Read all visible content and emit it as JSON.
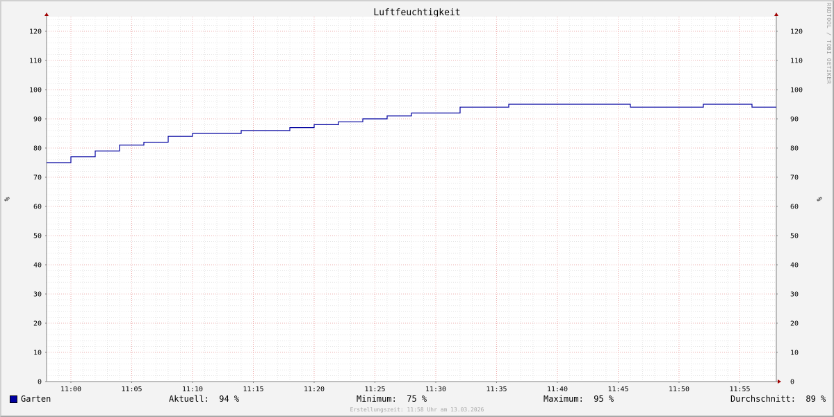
{
  "chart_data": {
    "type": "line",
    "title": "Luftfeuchtigkeit",
    "ylabel": "%",
    "ylim": [
      0,
      125
    ],
    "yticks": [
      0,
      10,
      20,
      30,
      40,
      50,
      60,
      70,
      80,
      90,
      100,
      110,
      120
    ],
    "xlim": [
      "10:58",
      "11:58"
    ],
    "xticks": [
      "11:00",
      "11:05",
      "11:10",
      "11:15",
      "11:20",
      "11:25",
      "11:30",
      "11:35",
      "11:40",
      "11:45",
      "11:50",
      "11:55"
    ],
    "grid": true,
    "line_style": "step",
    "series": [
      {
        "name": "Garten",
        "color": "#00009f",
        "points": [
          [
            "10:58",
            75
          ],
          [
            "11:00",
            77
          ],
          [
            "11:02",
            79
          ],
          [
            "11:04",
            81
          ],
          [
            "11:06",
            82
          ],
          [
            "11:08",
            84
          ],
          [
            "11:10",
            85
          ],
          [
            "11:14",
            86
          ],
          [
            "11:18",
            87
          ],
          [
            "11:20",
            88
          ],
          [
            "11:22",
            89
          ],
          [
            "11:24",
            90
          ],
          [
            "11:26",
            91
          ],
          [
            "11:28",
            92
          ],
          [
            "11:32",
            94
          ],
          [
            "11:36",
            95
          ],
          [
            "11:46",
            94
          ],
          [
            "11:52",
            95
          ],
          [
            "11:56",
            94
          ],
          [
            "11:58",
            94
          ]
        ]
      }
    ],
    "legend": {
      "position": "bottom",
      "aktuell": "Aktuell:  94 %",
      "minimum": "Minimum:  75 %",
      "maximum": "Maximum:  95 %",
      "durchschnitt": "Durchschnitt:  89 %"
    }
  },
  "watermark": "RRDTOOL / TOBI OETIKER",
  "created": "Erstellungszeit: 11:58 Uhr am 13.03.2026",
  "colors": {
    "major_grid": "#f0a0a0",
    "minor_grid": "#d8d8d8",
    "axis": "#808080",
    "arrow": "#a00000"
  }
}
